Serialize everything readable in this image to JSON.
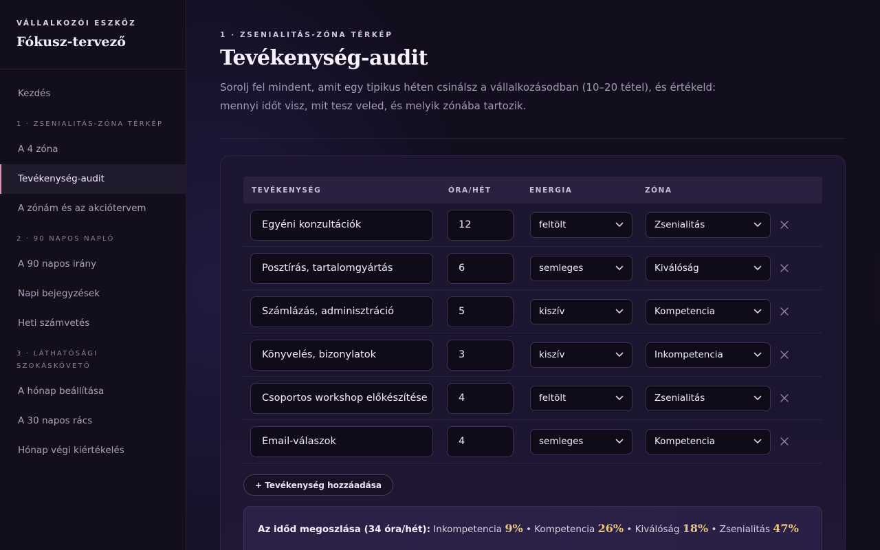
{
  "brand": {
    "eyebrow": "VÁLLALKOZÓI ESZKÖZ",
    "title": "Fókusz-tervező"
  },
  "nav": {
    "start": "Kezdés",
    "section1": "1 · ZSENIALITÁS-ZÓNA TÉRKÉP",
    "s1_items": [
      "A 4 zóna",
      "Tevékenység-audit",
      "A zónám és az akciótervem"
    ],
    "section2": "2 · 90 NAPOS NAPLÓ",
    "s2_items": [
      "A 90 napos irány",
      "Napi bejegyzések",
      "Heti számvetés"
    ],
    "section3": "3 · LÁTHATÓSÁGI SZOKÁSKÖVETŐ",
    "s3_items": [
      "A hónap beállítása",
      "A 30 napos rács",
      "Hónap végi kiértékelés"
    ]
  },
  "page": {
    "eyebrow": "1 · ZSENIALITÁS-ZÓNA TÉRKÉP",
    "title": "Tevékenység-audit",
    "subtitle": "Sorolj fel mindent, amit egy tipikus héten csinálsz a vállalkozásodban (10–20 tétel), és értékeld: mennyi időt visz, mit tesz veled, és melyik zónába tartozik."
  },
  "table": {
    "headers": {
      "activity": "TEVÉKENYSÉG",
      "hours": "ÓRA/HÉT",
      "energy": "ENERGIA",
      "zone": "ZÓNA"
    },
    "rows": [
      {
        "activity": "Egyéni konzultációk",
        "hours": "12",
        "energy": "feltölt",
        "zone": "Zsenialitás"
      },
      {
        "activity": "Posztírás, tartalomgyártás",
        "hours": "6",
        "energy": "semleges",
        "zone": "Kiválóság"
      },
      {
        "activity": "Számlázás, adminisztráció",
        "hours": "5",
        "energy": "kiszív",
        "zone": "Kompetencia"
      },
      {
        "activity": "Könyvelés, bizonylatok",
        "hours": "3",
        "energy": "kiszív",
        "zone": "Inkompetencia"
      },
      {
        "activity": "Csoportos workshop előkészítése",
        "hours": "4",
        "energy": "feltölt",
        "zone": "Zsenialitás"
      },
      {
        "activity": "Email-válaszok",
        "hours": "4",
        "energy": "semleges",
        "zone": "Kompetencia"
      }
    ],
    "add_label": "+ Tevékenység hozzáadása"
  },
  "summary": {
    "lead": "Az időd megoszlása (34 óra/hét):",
    "items": [
      {
        "label": "Inkompetencia",
        "pct": "9%"
      },
      {
        "label": "Kompetencia",
        "pct": "26%"
      },
      {
        "label": "Kiválóság",
        "pct": "18%"
      },
      {
        "label": "Zsenialitás",
        "pct": "47%"
      }
    ]
  }
}
